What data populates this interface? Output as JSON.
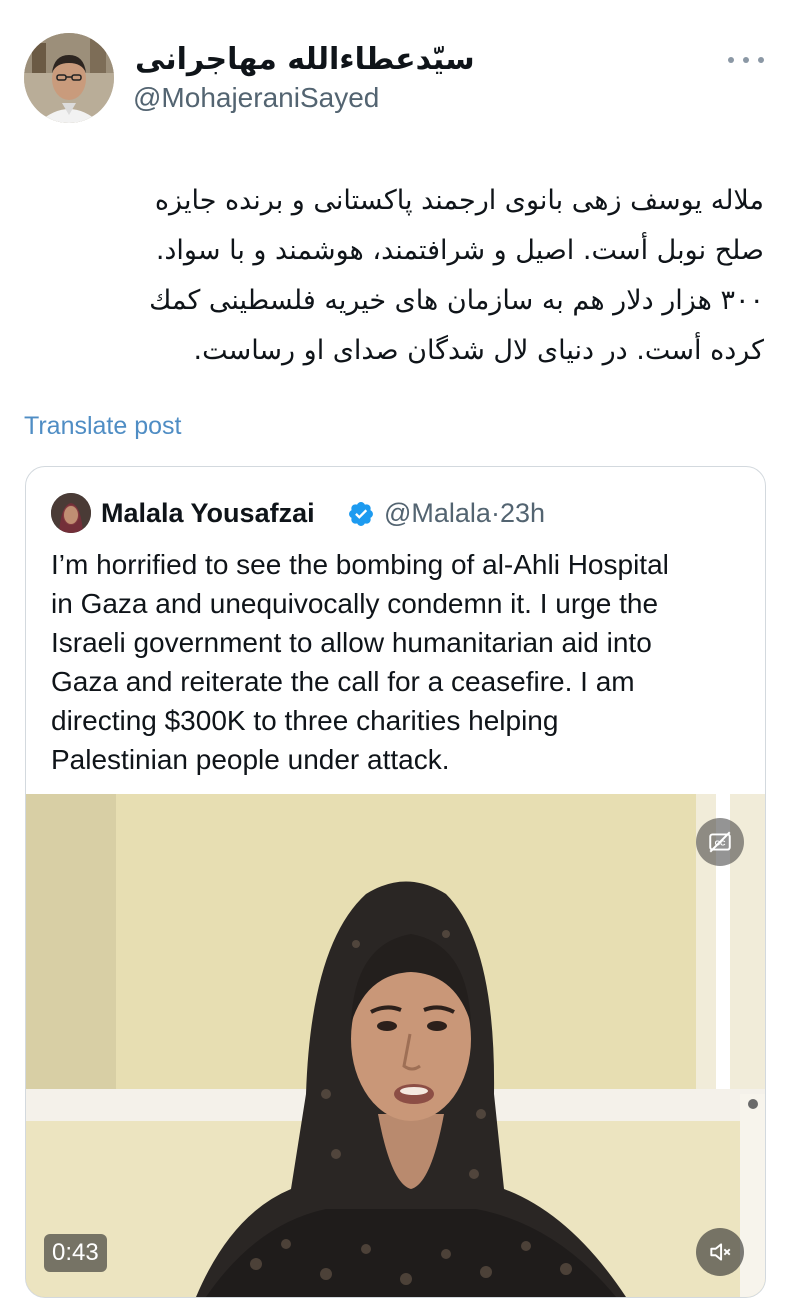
{
  "author": {
    "display_name": "سیّدعطاءالله مهاجرانی",
    "handle": "@MohajeraniSayed"
  },
  "post": {
    "lines": [
      "ملاله یوسف زهی بانوی ارجمند پاکستانی و برنده  جایزه",
      "صلح نوبل أست. اصیل و شرافتمند، هوشمند و با سواد.",
      "۳۰۰ هزار دلار هم به سازمان های خیریه فلسطینی کمك",
      "کرده أست. در دنیای لال شدگان صدای او رساست."
    ],
    "translate_label": "Translate post"
  },
  "quoted": {
    "display_name": "Malala Yousafzai",
    "handle": "@Malala",
    "separator": "·",
    "time": "23h",
    "lines": [
      "I’m horrified to see the bombing of al-Ahli Hospital",
      "in Gaza and unequivocally condemn it. I urge the",
      "Israeli government to allow humanitarian aid into",
      "Gaza and reiterate the call for a ceasefire. I am",
      "directing $300K to three charities helping",
      "Palestinian people under attack."
    ],
    "video": {
      "timestamp": "0:43"
    }
  },
  "icons": {
    "more": "more-dots-icon",
    "verified": "verified-badge-icon",
    "captions": "captions-off-icon",
    "mute": "muted-speaker-icon"
  },
  "colors": {
    "link": "#4f8dc4",
    "verified": "#1d9bf0",
    "secondary_text": "#536471"
  }
}
